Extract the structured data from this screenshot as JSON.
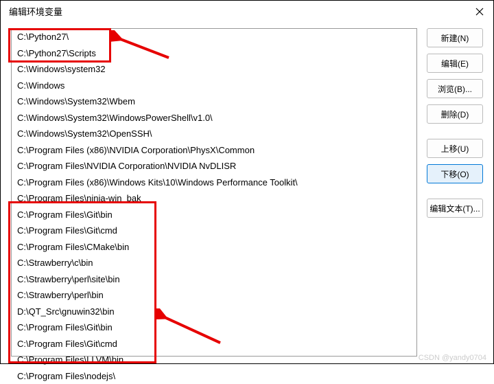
{
  "window": {
    "title": "编辑环境变量"
  },
  "paths": [
    "C:\\Python27\\",
    "C:\\Python27\\Scripts",
    "C:\\Windows\\system32",
    "C:\\Windows",
    "C:\\Windows\\System32\\Wbem",
    "C:\\Windows\\System32\\WindowsPowerShell\\v1.0\\",
    "C:\\Windows\\System32\\OpenSSH\\",
    "C:\\Program Files (x86)\\NVIDIA Corporation\\PhysX\\Common",
    "C:\\Program Files\\NVIDIA Corporation\\NVIDIA NvDLISR",
    "C:\\Program Files (x86)\\Windows Kits\\10\\Windows Performance Toolkit\\",
    "C:\\Program Files\\ninja-win_bak",
    "C:\\Program Files\\Git\\bin",
    "C:\\Program Files\\Git\\cmd",
    "C:\\Program Files\\CMake\\bin",
    "C:\\Strawberry\\c\\bin",
    "C:\\Strawberry\\perl\\site\\bin",
    "C:\\Strawberry\\perl\\bin",
    "D:\\QT_Src\\gnuwin32\\bin",
    "C:\\Program Files\\Git\\bin",
    "C:\\Program Files\\Git\\cmd",
    "C:\\Program Files\\LLVM\\bin",
    "C:\\Program Files\\nodejs\\"
  ],
  "buttons": {
    "new": "新建(N)",
    "edit": "编辑(E)",
    "browse": "浏览(B)...",
    "delete": "删除(D)",
    "moveUp": "上移(U)",
    "moveDown": "下移(O)",
    "editText": "编辑文本(T)..."
  },
  "watermark": "CSDN @yandy0704"
}
